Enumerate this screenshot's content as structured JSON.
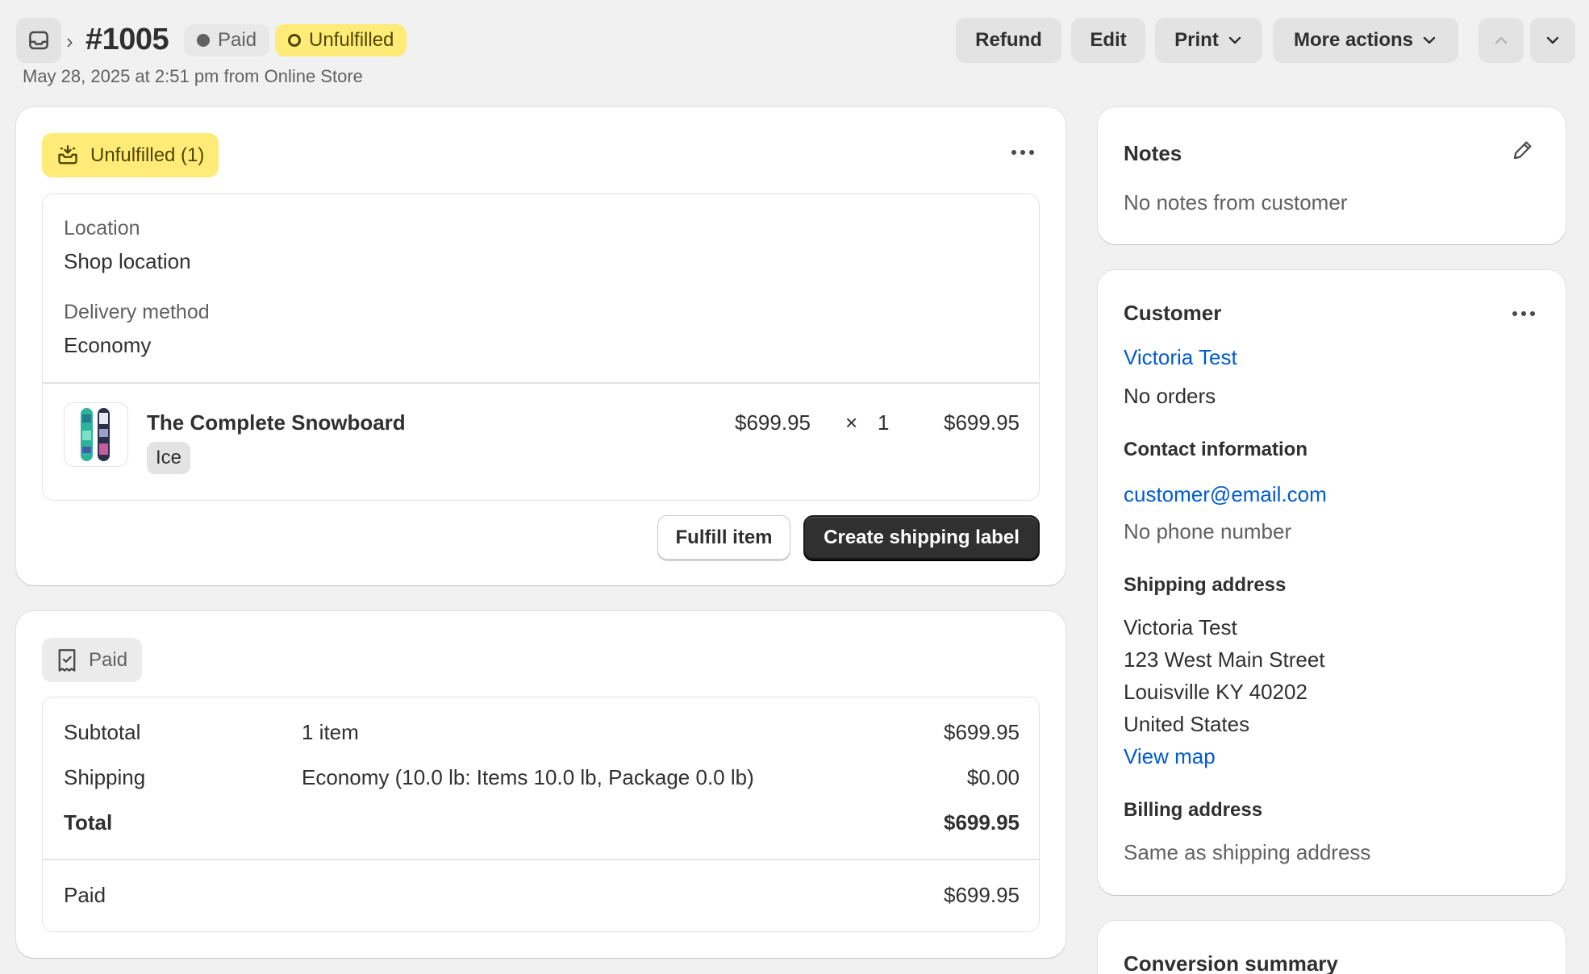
{
  "header": {
    "order_number": "#1005",
    "paid_label": "Paid",
    "unfulfilled_label": "Unfulfilled",
    "subtitle": "May 28, 2025 at 2:51 pm from Online Store",
    "buttons": {
      "refund": "Refund",
      "edit": "Edit",
      "print": "Print",
      "more_actions": "More actions"
    }
  },
  "fulfillment": {
    "badge": "Unfulfilled (1)",
    "location_label": "Location",
    "location_value": "Shop location",
    "delivery_label": "Delivery method",
    "delivery_value": "Economy",
    "item": {
      "name": "The Complete Snowboard",
      "variant": "Ice",
      "price": "$699.95",
      "times": "×",
      "quantity": "1",
      "total": "$699.95"
    },
    "fulfill_button": "Fulfill item",
    "shipping_label_button": "Create shipping label"
  },
  "payment": {
    "badge": "Paid",
    "rows": [
      {
        "label": "Subtotal",
        "detail": "1 item",
        "amount": "$699.95"
      },
      {
        "label": "Shipping",
        "detail": "Economy (10.0 lb: Items 10.0 lb, Package 0.0 lb)",
        "amount": "$0.00"
      },
      {
        "label": "Total",
        "detail": "",
        "amount": "$699.95"
      }
    ],
    "paid_label": "Paid",
    "paid_amount": "$699.95"
  },
  "notes": {
    "title": "Notes",
    "text": "No notes from customer"
  },
  "customer": {
    "title": "Customer",
    "name": "Victoria Test",
    "orders": "No orders",
    "contact_title": "Contact information",
    "email": "customer@email.com",
    "phone": "No phone number",
    "shipping_title": "Shipping address",
    "address_lines": [
      "Victoria Test",
      "123 West Main Street",
      "Louisville KY 40202",
      "United States"
    ],
    "view_map": "View map",
    "billing_title": "Billing address",
    "billing_text": "Same as shipping address"
  },
  "conversion": {
    "title": "Conversion summary"
  },
  "colors": {
    "unfulfilled_badge": "#ffeb78",
    "link": "#005bd3",
    "primary_button": "#303030",
    "background": "#f1f1f1"
  }
}
